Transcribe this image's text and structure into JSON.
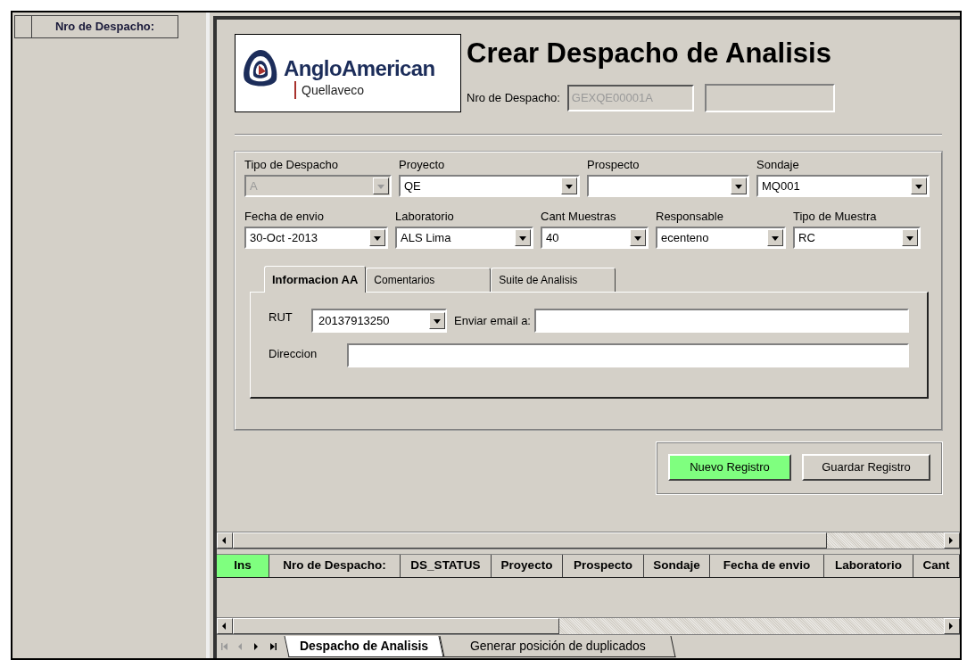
{
  "left_pane": {
    "column_header": "Nro de Despacho:"
  },
  "form": {
    "logo": {
      "brand": "AngloAmerican",
      "site": "Quellaveco"
    },
    "title": "Crear Despacho de Analisis",
    "dispatch_number": {
      "label": "Nro de Despacho:",
      "value": "GEXQE00001A",
      "disabled": true
    },
    "fields_row_1": [
      {
        "label": "Tipo de Despacho",
        "value": "A",
        "disabled": true
      },
      {
        "label": "Proyecto",
        "value": "QE",
        "disabled": false
      },
      {
        "label": "Prospecto",
        "disabled": false
      },
      {
        "label": "Sondaje",
        "value": "MQ001",
        "disabled": false
      }
    ],
    "fields_row_2": [
      {
        "label": "Fecha de envio",
        "value": "30-Oct -2013",
        "disabled": false
      },
      {
        "label": "Laboratorio",
        "value": "ALS Lima",
        "disabled": false
      },
      {
        "label": "Cant Muestras",
        "value": "40",
        "disabled": false
      },
      {
        "label": "Responsable",
        "value": "ecenteno",
        "disabled": false
      },
      {
        "label": "Tipo de Muestra",
        "value": "RC",
        "disabled": false
      }
    ],
    "tabs": [
      {
        "label": "Informacion AA",
        "selected": true
      },
      {
        "label": "Comentarios",
        "selected": false
      },
      {
        "label": "Suite de Analisis",
        "selected": false
      }
    ],
    "rut": {
      "label": "RUT",
      "value": "20137913250"
    },
    "email": {
      "label": "Enviar email a:"
    },
    "address": {
      "label": "Direccion"
    },
    "buttons": [
      {
        "label": "Nuevo Registro",
        "highlighted": true
      },
      {
        "label": "Guardar Registro",
        "highlighted": false
      }
    ]
  },
  "grid": {
    "columns": [
      {
        "label": "Ins",
        "highlighted": true
      },
      {
        "label": "Nro de Despacho:",
        "highlighted": false
      },
      {
        "label": "DS_STATUS",
        "highlighted": false
      },
      {
        "label": "Proyecto",
        "highlighted": false
      },
      {
        "label": "Prospecto",
        "highlighted": false
      },
      {
        "label": "Sondaje",
        "highlighted": false
      },
      {
        "label": "Fecha de envio",
        "highlighted": false
      },
      {
        "label": "Laboratorio",
        "highlighted": false
      },
      {
        "label": "Cant",
        "highlighted": false
      }
    ]
  },
  "sheet_tabs": [
    {
      "label": "Despacho de Analisis",
      "selected": true
    },
    {
      "label": "Generar posición de duplicados",
      "selected": false
    }
  ]
}
